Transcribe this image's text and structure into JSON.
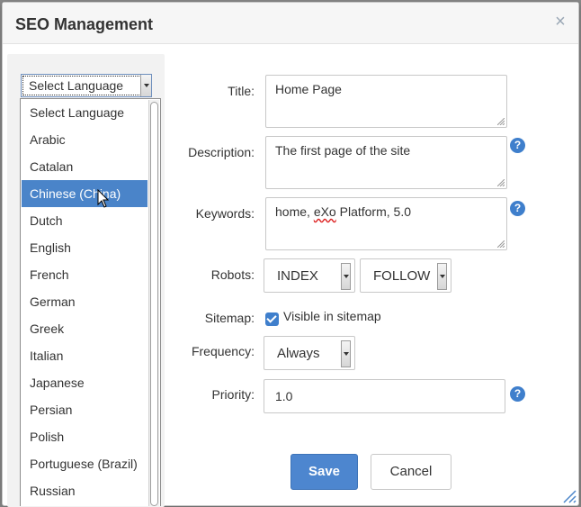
{
  "dialog": {
    "title": "SEO Management",
    "close_glyph": "×"
  },
  "language_select": {
    "selected": "Select Language",
    "options": [
      "Select Language",
      "Arabic",
      "Catalan",
      "Chinese (China)",
      "Dutch",
      "English",
      "French",
      "German",
      "Greek",
      "Italian",
      "Japanese",
      "Persian",
      "Polish",
      "Portuguese (Brazil)",
      "Russian"
    ],
    "highlighted": "Chinese (China)"
  },
  "form": {
    "title_label": "Title:",
    "title_value": "Home Page",
    "description_label": "Description:",
    "description_value": "The first page of the site",
    "keywords_label": "Keywords:",
    "keywords_value_prefix": "home, ",
    "keywords_value_misspelled": "eXo",
    "keywords_value_suffix": " Platform, 5.0",
    "robots_label": "Robots:",
    "robots_index": "INDEX",
    "robots_follow": "FOLLOW",
    "sitemap_label": "Sitemap:",
    "sitemap_checkbox_label": "Visible in sitemap",
    "sitemap_checked": true,
    "frequency_label": "Frequency:",
    "frequency_value": "Always",
    "priority_label": "Priority:",
    "priority_value": "1.0",
    "help_glyph": "?"
  },
  "buttons": {
    "save": "Save",
    "cancel": "Cancel"
  },
  "colors": {
    "accent": "#4a84c9",
    "primary_button": "#4d86cf",
    "help_icon": "#3f7fcc"
  },
  "icons": [
    "close-icon",
    "help-icon",
    "checkbox-checked-icon",
    "dropdown-arrow-icon",
    "mouse-cursor-icon",
    "resize-grip-icon"
  ]
}
